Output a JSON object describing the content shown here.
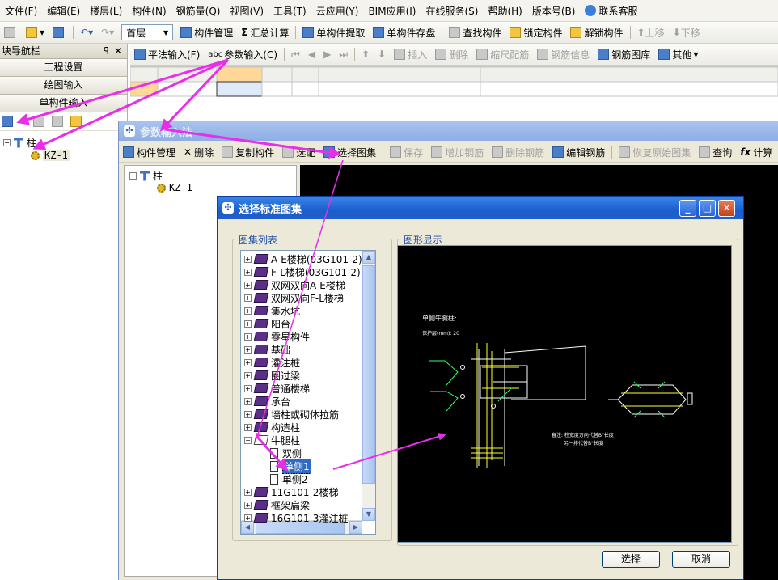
{
  "menu": [
    "文件(F)",
    "编辑(E)",
    "楼层(L)",
    "构件(N)",
    "钢筋量(Q)",
    "视图(V)",
    "工具(T)",
    "云应用(Y)",
    "BIM应用(I)",
    "在线服务(S)",
    "帮助(H)",
    "版本号(B)",
    "联系客服"
  ],
  "toolbar1": {
    "floor_select": "首层",
    "buttons": [
      "构件管理",
      "汇总计算",
      "单构件提取",
      "单构件存盘",
      "查找构件",
      "锁定构件",
      "解锁构件",
      "上移",
      "下移"
    ],
    "sigma": "Σ"
  },
  "toolbar2": {
    "buttons": [
      "平法输入(F)",
      "参数输入(C)",
      "插入",
      "删除",
      "缩尺配筋",
      "钢筋信息",
      "钢筋图库",
      "其他"
    ],
    "abc": "abc"
  },
  "nav": {
    "title": "块导航栏",
    "pin": "ꟼ",
    "close": "✕",
    "buttons": [
      "工程设置",
      "绘图输入",
      "单构件输入"
    ],
    "tree": {
      "root": "柱",
      "child": "KZ-1"
    }
  },
  "param_window": {
    "title": "参数输入法",
    "buttons": [
      "构件管理",
      "删除",
      "复制构件",
      "选配",
      "选择图集",
      "保存",
      "增加钢筋",
      "删除钢筋",
      "编辑钢筋",
      "恢复原始图集",
      "查询",
      "计算"
    ],
    "tree": {
      "root": "柱",
      "child": "KZ-1"
    }
  },
  "dialog": {
    "title": "选择标准图集",
    "list_label": "图集列表",
    "preview_label": "图形显示",
    "items": [
      "A-E楼梯(03G101-2)",
      "F-L楼梯(03G101-2)",
      "双网双向A-E楼梯",
      "双网双向F-L楼梯",
      "集水坑",
      "阳台",
      "零星构件",
      "基础",
      "灌注桩",
      "圈过梁",
      "普通楼梯",
      "承台",
      "墙柱或砌体拉筋",
      "构造柱",
      "牛腿柱"
    ],
    "subitems": [
      "双侧",
      "单侧1",
      "单侧2"
    ],
    "after_items": [
      "11G101-2楼梯",
      "框架扁梁",
      "16G101-3灌注桩"
    ],
    "ok": "选择",
    "cancel": "取消",
    "preview": {
      "title": "单侧牛腿柱:",
      "line2": "保护层(mm): 20",
      "note1": "备注: 柱宽度方向代替B\"长度",
      "note2": "另一排代替B\"长度"
    }
  },
  "colors": {
    "accent": "#1f5fc7",
    "arrow": "#e82ee8",
    "selection": "#316ac5"
  }
}
